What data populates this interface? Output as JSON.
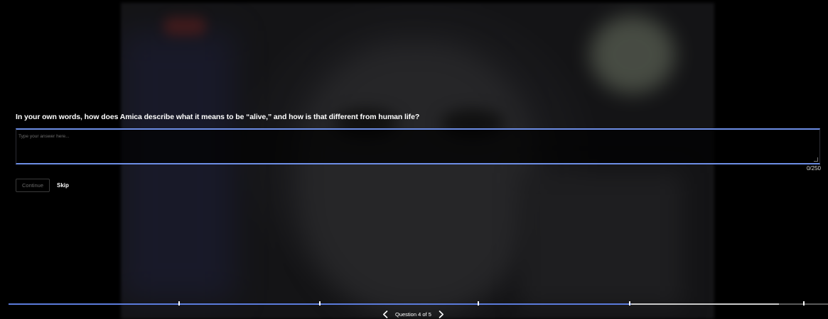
{
  "question": {
    "text": "In your own words, how does Amica describe what it means to be “alive,” and how is that different from human life?"
  },
  "answer": {
    "value": "",
    "placeholder": "Type your answer here...",
    "char_count": "0/250"
  },
  "actions": {
    "continue_label": "Continue",
    "skip_label": "Skip"
  },
  "progress": {
    "current": 4,
    "total": 5,
    "label": "Question 4 of 5",
    "completed_fraction": 0.76,
    "upcoming_fraction": 0.94
  },
  "icons": {
    "prev": "chevron-left-icon",
    "next": "chevron-right-icon"
  },
  "colors": {
    "accent": "#5b7bdb",
    "background": "#000000",
    "text": "#ffffff"
  }
}
